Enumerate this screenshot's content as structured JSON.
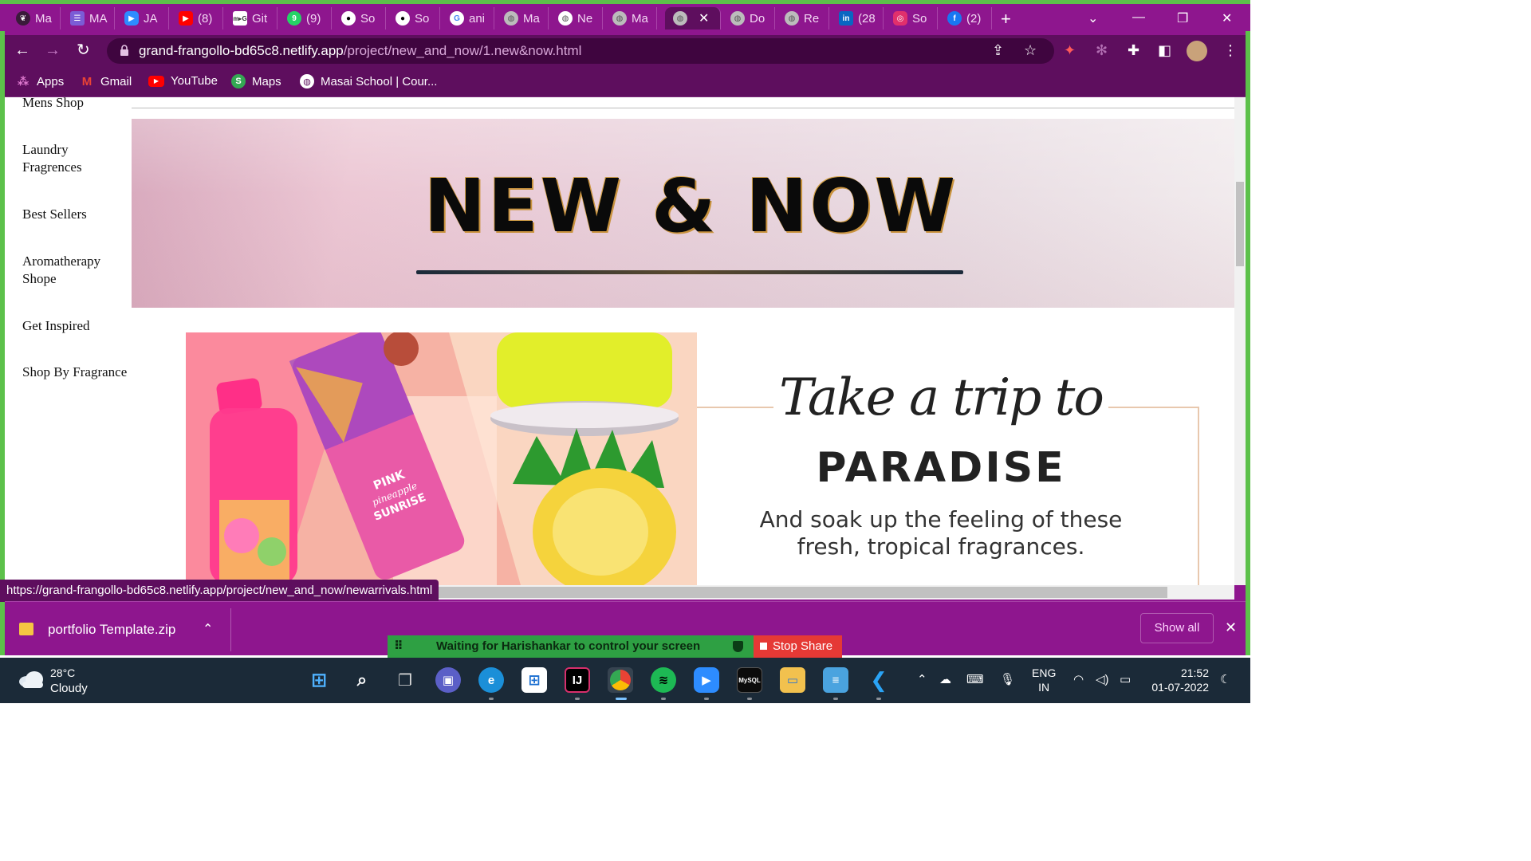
{
  "browser": {
    "tabs": [
      {
        "label": "Ma",
        "icon": "masai-icon",
        "color": "#ffffff"
      },
      {
        "label": "MA",
        "icon": "forms-icon",
        "color": "#7b5cd6"
      },
      {
        "label": "JA",
        "icon": "zoom-icon",
        "color": "#2d8cff"
      },
      {
        "label": "(8)",
        "icon": "youtube-icon",
        "color": "#ff0000"
      },
      {
        "label": "Git",
        "icon": "git-icon",
        "color": "#ffffff"
      },
      {
        "label": "(9)",
        "icon": "whatsapp-icon",
        "color": "#25d366"
      },
      {
        "label": "So",
        "icon": "github-icon",
        "color": "#ffffff"
      },
      {
        "label": "So",
        "icon": "github-icon",
        "color": "#ffffff"
      },
      {
        "label": "ani",
        "icon": "google-icon",
        "color": "#ffffff"
      },
      {
        "label": "Ma",
        "icon": "globe-icon",
        "color": "#cfcfcf"
      },
      {
        "label": "Ne",
        "icon": "globe-icon",
        "color": "#ffffff"
      },
      {
        "label": "Ma",
        "icon": "globe-icon",
        "color": "#cfcfcf"
      },
      {
        "label": "",
        "icon": "globe-icon",
        "color": "#cfcfcf",
        "active": true
      },
      {
        "label": "Do",
        "icon": "globe-icon",
        "color": "#cfcfcf"
      },
      {
        "label": "Re",
        "icon": "globe-icon",
        "color": "#cfcfcf"
      },
      {
        "label": "(28",
        "icon": "linkedin-icon",
        "color": "#0a66c2"
      },
      {
        "label": "So",
        "icon": "instagram-icon",
        "color": "#e1306c"
      },
      {
        "label": "(2)",
        "icon": "facebook-icon",
        "color": "#1877f2"
      }
    ],
    "new_tab_glyph": "+",
    "url_host": "grand-frangollo-bd65c8.netlify.app",
    "url_path": "/project/new_and_now/1.new&now.html",
    "bookmarks": [
      {
        "label": "Apps",
        "icon": "apps-grid-icon"
      },
      {
        "label": "Gmail",
        "icon": "gmail-icon"
      },
      {
        "label": "YouTube",
        "icon": "youtube-icon"
      },
      {
        "label": "Maps",
        "icon": "maps-icon"
      },
      {
        "label": "Masai School | Cour...",
        "icon": "masai-icon"
      }
    ],
    "status_url": "https://grand-frangollo-bd65c8.netlify.app/project/new_and_now/newarrivals.html"
  },
  "page": {
    "sidebar": [
      "Mens Shop",
      "Laundry Fragrences",
      "Best Sellers",
      "Aromatherapy Shope",
      "Get Inspired",
      "Shop By Fragrance"
    ],
    "hero_title": "NEW & NOW",
    "promo_script": "Take a trip to",
    "promo_heading": "PARADISE",
    "promo_sub": "And soak up the feeling of these fresh, tropical fragrances.",
    "product_label_line1": "PINK",
    "product_label_line2": "pineapple",
    "product_label_line3": "SUNRISE"
  },
  "downloads": {
    "file_name": "portfolio Template.zip",
    "show_all": "Show all"
  },
  "screen_share": {
    "message": "Waiting for Harishankar to control your screen",
    "stop_label": "Stop Share"
  },
  "taskbar": {
    "temperature": "28°C",
    "weather": "Cloudy",
    "lang_line1": "ENG",
    "lang_line2": "IN",
    "time": "21:52",
    "date": "01-07-2022"
  },
  "colors": {
    "browser_frame": "#8e168e",
    "browser_toolbar": "#5e0e5e",
    "share_green": "#2ea043",
    "stop_red": "#e53935"
  }
}
